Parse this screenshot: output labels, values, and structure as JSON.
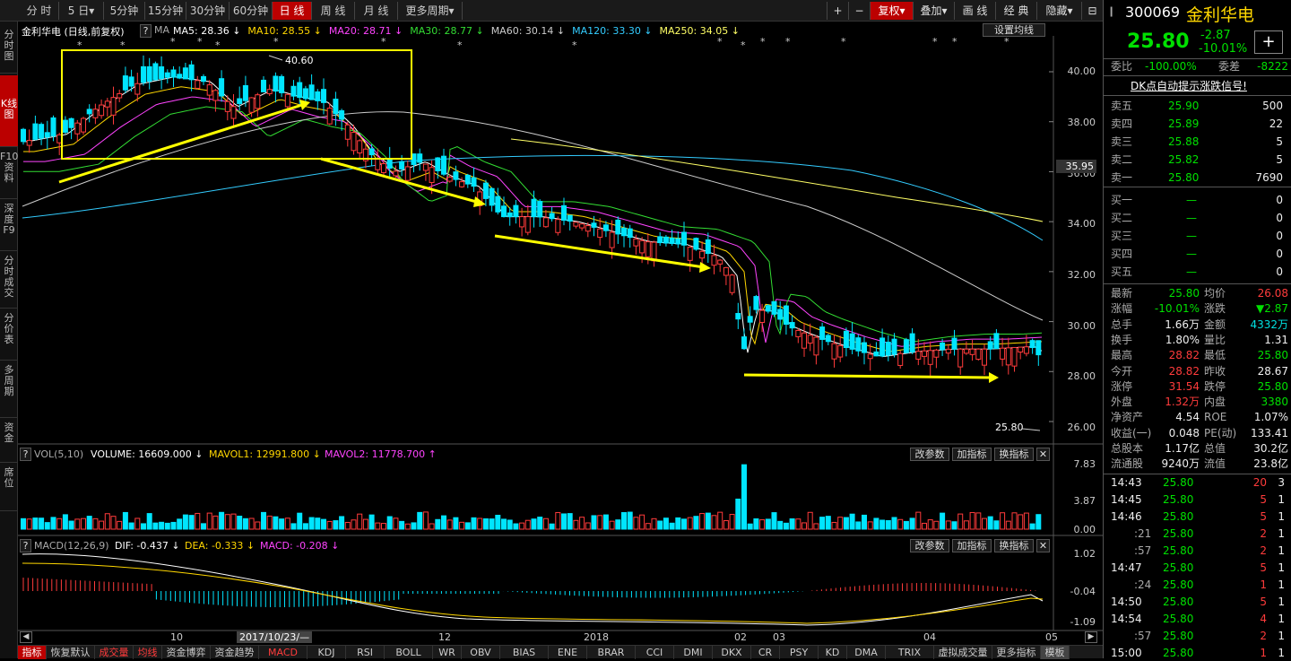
{
  "topbar": {
    "tabs": [
      "分 时",
      "5 日▾",
      "5分钟",
      "15分钟",
      "30分钟",
      "60分钟",
      "日 线",
      "周 线",
      "月 线",
      "更多周期▾"
    ],
    "right": [
      "+",
      "−",
      "复权▾",
      "叠加▾",
      "画 线",
      "经 典",
      "隐藏▾",
      "⊟",
      "⊠"
    ]
  },
  "leftbar": [
    "分时图",
    "K线图",
    "F10资料",
    "深度F9",
    "分时成交",
    "分价表",
    "多周期",
    "资金",
    "席位"
  ],
  "main": {
    "title": "金利华电 (日线,前复权)",
    "ma_label": "MA",
    "ma": [
      {
        "text": "MA5: 28.36 ↓",
        "color": "#ffffff"
      },
      {
        "text": "MA10: 28.55 ↓",
        "color": "#ffd700"
      },
      {
        "text": "MA20: 28.71 ↓",
        "color": "#ff44ff"
      },
      {
        "text": "MA30: 28.77 ↓",
        "color": "#33dd33"
      },
      {
        "text": "MA60: 30.14 ↓",
        "color": "#cccccc"
      },
      {
        "text": "MA120: 33.30 ↓",
        "color": "#33ccff"
      },
      {
        "text": "MA250: 34.05 ↓",
        "color": "#ffff66"
      }
    ],
    "settings": "设置均线",
    "price_axis": [
      "40.00",
      "38.00",
      "36.00",
      "34.00",
      "32.00",
      "30.00",
      "28.00",
      "26.00"
    ],
    "current_price_tag": "35.95",
    "high_label": "40.60",
    "low_label": "25.80"
  },
  "vol": {
    "title": "VOL(5,10)",
    "volume": "VOLUME: 16609.000 ↓",
    "mavol1": "MAVOL1: 12991.800 ↓",
    "mavol2": "MAVOL2: 11778.700 ↑",
    "axis": [
      "7.83",
      "3.87",
      "0.00"
    ],
    "buttons": [
      "改参数",
      "加指标",
      "换指标",
      "✕"
    ]
  },
  "macd": {
    "title": "MACD(12,26,9)",
    "dif": "DIF: -0.437 ↓",
    "dea": "DEA: -0.333 ↓",
    "macd": "MACD: -0.208 ↓",
    "axis": [
      "1.02",
      "-0.04",
      "-1.09"
    ],
    "buttons": [
      "改参数",
      "加指标",
      "换指标",
      "✕"
    ]
  },
  "xaxis": [
    "10",
    "2017/10/23/—",
    "12",
    "2018",
    "02",
    "03",
    "04",
    "05"
  ],
  "bottombar": [
    "指标",
    "恢复默认",
    "成交量",
    "均线",
    "资金博弈",
    "资金趋势",
    "MACD",
    "KDJ",
    "RSI",
    "BOLL",
    "WR",
    "OBV",
    "BIAS",
    "ENE",
    "BRAR",
    "CCI",
    "DMI",
    "DKX",
    "CR",
    "PSY",
    "KD",
    "DMA",
    "TRIX",
    "虚拟成交量",
    "更多指标",
    "模板"
  ],
  "stock": {
    "code": "300069",
    "name": "金利华电",
    "price": "25.80",
    "change": "-2.87",
    "pct": "-10.01%",
    "weibi_label": "委比",
    "weibi": "-100.00%",
    "weicha_label": "委差",
    "weicha": "-8222",
    "dk": "DK点自动提示涨跌信号!",
    "sell": [
      [
        "卖五",
        "25.90",
        "500"
      ],
      [
        "卖四",
        "25.89",
        "22"
      ],
      [
        "卖三",
        "25.88",
        "5"
      ],
      [
        "卖二",
        "25.82",
        "5"
      ],
      [
        "卖一",
        "25.80",
        "7690"
      ]
    ],
    "buy": [
      [
        "买一",
        "—",
        "0"
      ],
      [
        "买二",
        "—",
        "0"
      ],
      [
        "买三",
        "—",
        "0"
      ],
      [
        "买四",
        "—",
        "0"
      ],
      [
        "买五",
        "—",
        "0"
      ]
    ],
    "stats": [
      [
        "最新",
        "25.80",
        "green",
        "均价",
        "26.08",
        "red"
      ],
      [
        "涨幅",
        "-10.01%",
        "green",
        "涨跌",
        "▼2.87",
        "green"
      ],
      [
        "总手",
        "1.66万",
        "white",
        "金额",
        "4332万",
        "cyan"
      ],
      [
        "换手",
        "1.80%",
        "white",
        "量比",
        "1.31",
        "white"
      ],
      [
        "最高",
        "28.82",
        "red",
        "最低",
        "25.80",
        "green"
      ],
      [
        "今开",
        "28.82",
        "red",
        "昨收",
        "28.67",
        "white"
      ],
      [
        "涨停",
        "31.54",
        "red",
        "跌停",
        "25.80",
        "green"
      ],
      [
        "外盘",
        "1.32万",
        "red",
        "内盘",
        "3380",
        "green"
      ],
      [
        "净资产",
        "4.54",
        "white",
        "ROE",
        "1.07%",
        "white"
      ],
      [
        "收益(一)",
        "0.048",
        "white",
        "PE(动)",
        "133.41",
        "white"
      ],
      [
        "总股本",
        "1.17亿",
        "white",
        "总值",
        "30.2亿",
        "white"
      ],
      [
        "流通股",
        "9240万",
        "white",
        "流值",
        "23.8亿",
        "white"
      ]
    ],
    "ticks": [
      [
        "14:43",
        "25.80",
        "20",
        "3"
      ],
      [
        "14:45",
        "25.80",
        "5",
        "1"
      ],
      [
        "14:46",
        "25.80",
        "5",
        "1"
      ],
      [
        ":21",
        "25.80",
        "2",
        "1"
      ],
      [
        ":57",
        "25.80",
        "2",
        "1"
      ],
      [
        "14:47",
        "25.80",
        "5",
        "1"
      ],
      [
        ":24",
        "25.80",
        "1",
        "1"
      ],
      [
        "14:50",
        "25.80",
        "5",
        "1"
      ],
      [
        "14:54",
        "25.80",
        "4",
        "1"
      ],
      [
        ":57",
        "25.80",
        "2",
        "1"
      ],
      [
        "15:00",
        "25.80",
        "1",
        "1"
      ]
    ]
  }
}
